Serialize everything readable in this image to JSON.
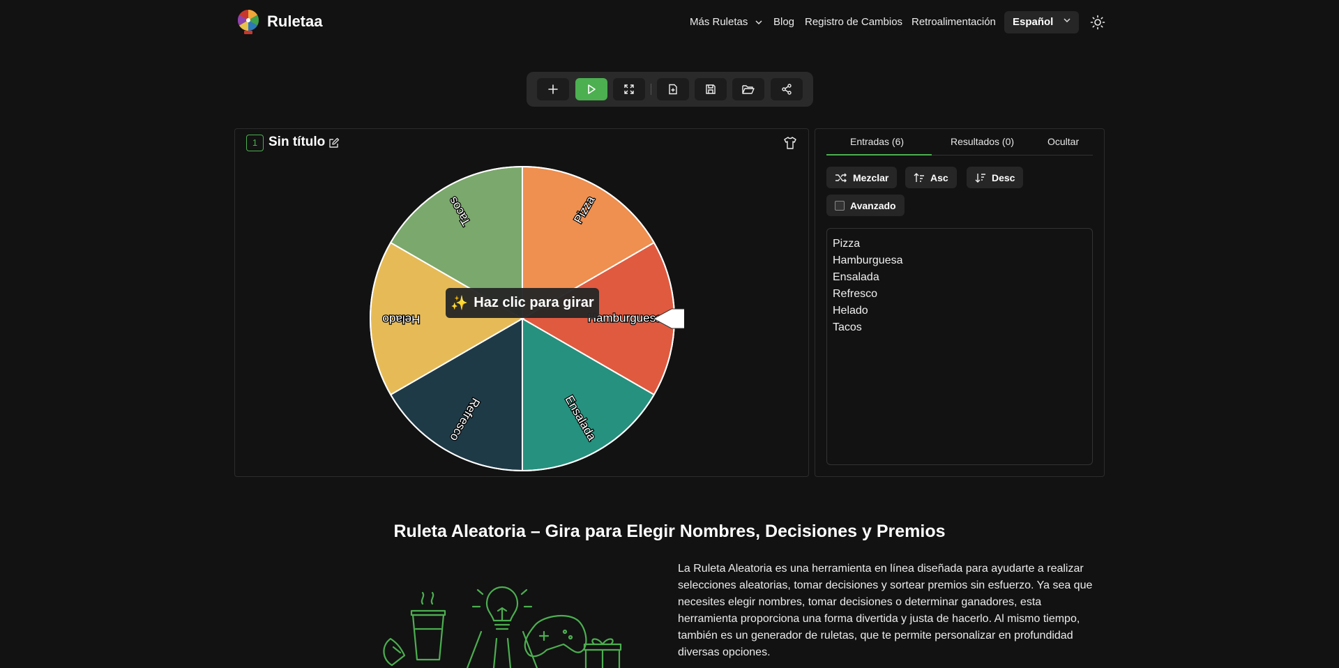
{
  "header": {
    "brand": "Ruletaa",
    "nav": [
      "Más Ruletas",
      "Blog",
      "Registro de Cambios",
      "Retroalimentación"
    ],
    "language": "Español"
  },
  "wheel": {
    "number": "1",
    "title": "Sin título",
    "spin_prompt": "Haz clic para girar",
    "segments": [
      {
        "label": "Pizza",
        "color": "#EF8F50"
      },
      {
        "label": "Hamburguesa",
        "color": "#E05A40"
      },
      {
        "label": "Ensalada",
        "color": "#26917E"
      },
      {
        "label": "Refresco",
        "color": "#1F3A47"
      },
      {
        "label": "Helado",
        "color": "#E6BB57"
      },
      {
        "label": "Tacos",
        "color": "#7BA86C"
      }
    ]
  },
  "entries_panel": {
    "tabs": [
      "Entradas (6)",
      "Resultados (0)",
      "Ocultar"
    ],
    "buttons": {
      "shuffle": "Mezclar",
      "asc": "Asc",
      "desc": "Desc",
      "advanced": "Avanzado"
    },
    "entries": [
      "Pizza",
      "Hamburguesa",
      "Ensalada",
      "Refresco",
      "Helado",
      "Tacos"
    ]
  },
  "content": {
    "title": "Ruleta Aleatoria – Gira para Elegir Nombres, Decisiones y Premios",
    "description": "La Ruleta Aleatoria es una herramienta en línea diseñada para ayudarte a realizar selecciones aleatorias, tomar decisiones y sortear premios sin esfuerzo. Ya sea que necesites elegir nombres, tomar decisiones o determinar ganadores, esta herramienta proporciona una forma divertida y justa de hacerlo. Al mismo tiempo, también es un generador de ruletas, que te permite personalizar en profundidad diversas opciones."
  },
  "colors": {
    "accent": "#4CAF50",
    "background": "#121212"
  }
}
